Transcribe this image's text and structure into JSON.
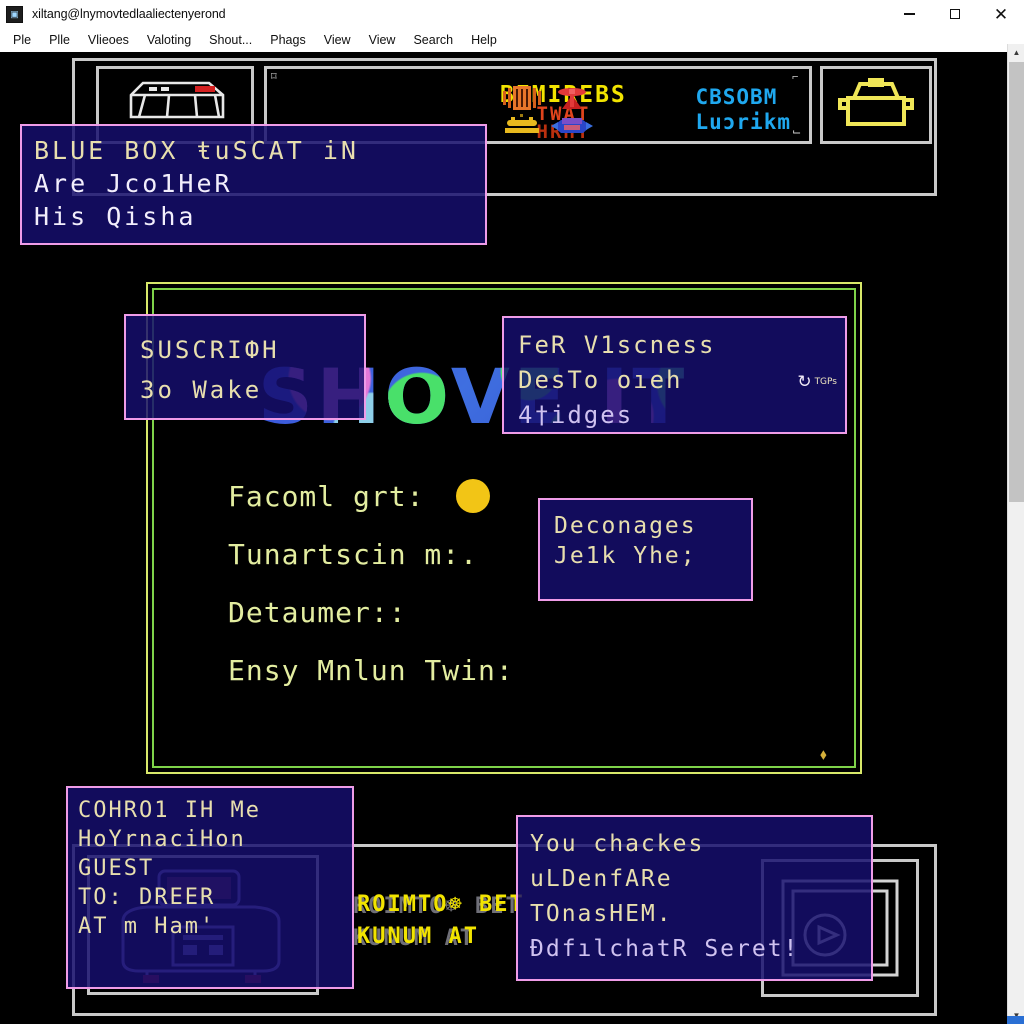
{
  "window": {
    "title": "xiltang@lnymovtedlaaliectenyerond",
    "icon": "app-icon",
    "buttons": {
      "minimize": "–",
      "maximize": "□",
      "close": "✕"
    }
  },
  "menubar": {
    "items": [
      "Ple",
      "Plle",
      "Vlieoes",
      "Valoting",
      "Shout...",
      "Phags",
      "View",
      "View",
      "Search",
      "Help"
    ]
  },
  "hud": {
    "title": {
      "line1": "BEMIREBS",
      "line2": "TWAT",
      "line3": "HRHT"
    },
    "right_text": {
      "line1": "CBSOBM",
      "line2": "Luɔrikm"
    },
    "icons": [
      "orange-barcode-icon",
      "red-figure-icon",
      "gold-emblem-icon",
      "blue-emblem-icon"
    ],
    "vehicle_icon": "wireframe-vehicle-icon",
    "car_icon": "yellow-car-icon",
    "corner_marks": [
      "⌑",
      "⌐",
      "⌙",
      "⌒"
    ]
  },
  "logo": {
    "text": "SHOVE IT"
  },
  "menu_lines": [
    {
      "text": "Facoml grt:",
      "swatch": "#f2c516"
    },
    {
      "text": "Tunartscin m:.",
      "swatch": null
    },
    {
      "text": "Detaumer::",
      "swatch": null
    },
    {
      "text": "Ensy Mnlun Twin:",
      "swatch": null
    }
  ],
  "recycle_icon": "⬧",
  "overlays": {
    "blue_box": {
      "lines": [
        {
          "text": "BLUE BOX  ŧuSCAT iN",
          "color": "tan"
        },
        {
          "text": "Are Jco1НeR",
          "color": "white"
        },
        {
          "text": "His Qisha",
          "color": "white"
        }
      ]
    },
    "suscrigh": {
      "lines": [
        {
          "text": "SUSCRIФH",
          "color": "tan"
        },
        {
          "text": "Зo Wake",
          "color": "tan"
        }
      ]
    },
    "fer": {
      "lines": [
        {
          "text": "FeR V1scness",
          "color": "tan"
        },
        {
          "text": "DesTo oıeh",
          "color": "tan"
        },
        {
          "text": "4†idges",
          "color": "lav"
        }
      ],
      "badge": {
        "glyph": "↻",
        "label": "TGPs"
      }
    },
    "deconages": {
      "lines": [
        {
          "text": "Deconages",
          "color": "tan"
        },
        {
          "text": "Je1k Yhe;",
          "color": "tan"
        }
      ]
    },
    "conroi": {
      "lines": [
        {
          "text": "COНRO1 IН Me",
          "color": "tan"
        },
        {
          "text": "НoYrnaciНon",
          "color": "tan"
        },
        {
          "text": "GUEST",
          "color": "tan"
        },
        {
          "text": "TO: DREER",
          "color": "tan"
        },
        {
          "text": "AT m Ham'",
          "color": "tan"
        }
      ]
    },
    "you_chackes": {
      "lines": [
        {
          "text": "You chackes",
          "color": "tan"
        },
        {
          "text": "uLDenfARe",
          "color": "tan"
        },
        {
          "text": "TOnasHEM.",
          "color": "tan"
        },
        {
          "text": "ĐdfılchatR Seret!",
          "color": "lav"
        }
      ]
    }
  },
  "bottom_hud": {
    "text": {
      "line1": "ROIMTO☸ BET",
      "line2": "KUNUM AT"
    },
    "left_icon": "boombox-icon",
    "right_icon": "cassette-icon"
  },
  "scrollbar": {
    "up": "▲",
    "down": "▼"
  },
  "colors": {
    "overlay_border": "#ef9ce8",
    "overlay_fill": "#160e6e",
    "hud_yellow": "#f2e400",
    "hud_blue": "#1fa8ef",
    "panel_green": "#7fd34a",
    "menu_text": "#e3eda0"
  }
}
